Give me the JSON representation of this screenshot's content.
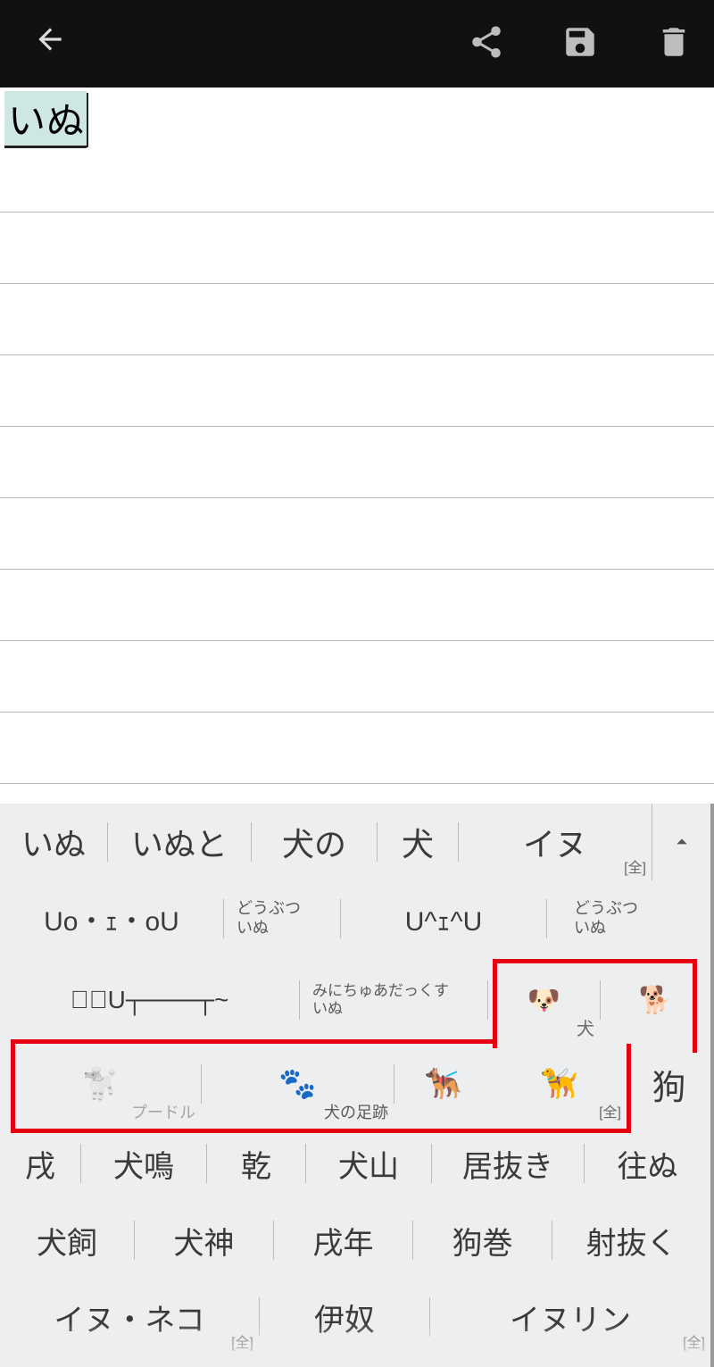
{
  "editor": {
    "composing_text": "いぬ"
  },
  "ime": {
    "row1": [
      {
        "text": "いぬ"
      },
      {
        "text": "いぬと"
      },
      {
        "text": "犬の"
      },
      {
        "text": "犬"
      },
      {
        "text": "イヌ",
        "tag": "[全]"
      }
    ],
    "row2": [
      {
        "text": "Uo・ｪ・oU"
      },
      {
        "text": "",
        "sub_top": "どうぶつ",
        "sub_bot": "いぬ"
      },
      {
        "text": "U^ｪ^U"
      },
      {
        "text": "",
        "sub_top": "どうぶつ",
        "sub_bot": "いぬ"
      }
    ],
    "row3a": [
      {
        "text": "⊂ﾟU┬───┬~"
      },
      {
        "text": "",
        "sub_top": "みにちゅあだっくす",
        "sub_bot": "いぬ"
      },
      {
        "emoji": "🐶",
        "tag_right": "犬"
      },
      {
        "emoji": "🐕"
      }
    ],
    "row3b": [
      {
        "emoji": "🐩",
        "tag_right": "プードル",
        "faded": true
      },
      {
        "emoji": "🐾",
        "tag_right": "犬の足跡"
      },
      {
        "emoji": "🐕‍🦺"
      },
      {
        "emoji": "🦮",
        "tag": "[全]"
      },
      {
        "text": "狗"
      }
    ],
    "row4": [
      {
        "text": "戌"
      },
      {
        "text": "犬鳴"
      },
      {
        "text": "乾"
      },
      {
        "text": "犬山"
      },
      {
        "text": "居抜き"
      },
      {
        "text": "往ぬ"
      }
    ],
    "row5": [
      {
        "text": "犬飼"
      },
      {
        "text": "犬神"
      },
      {
        "text": "戌年"
      },
      {
        "text": "狗巻"
      },
      {
        "text": "射抜く"
      }
    ],
    "row6": [
      {
        "text": "イヌ・ネコ",
        "tag": "[全]"
      },
      {
        "text": "伊奴"
      },
      {
        "text": "イヌリン",
        "tag": "[全]"
      }
    ]
  }
}
